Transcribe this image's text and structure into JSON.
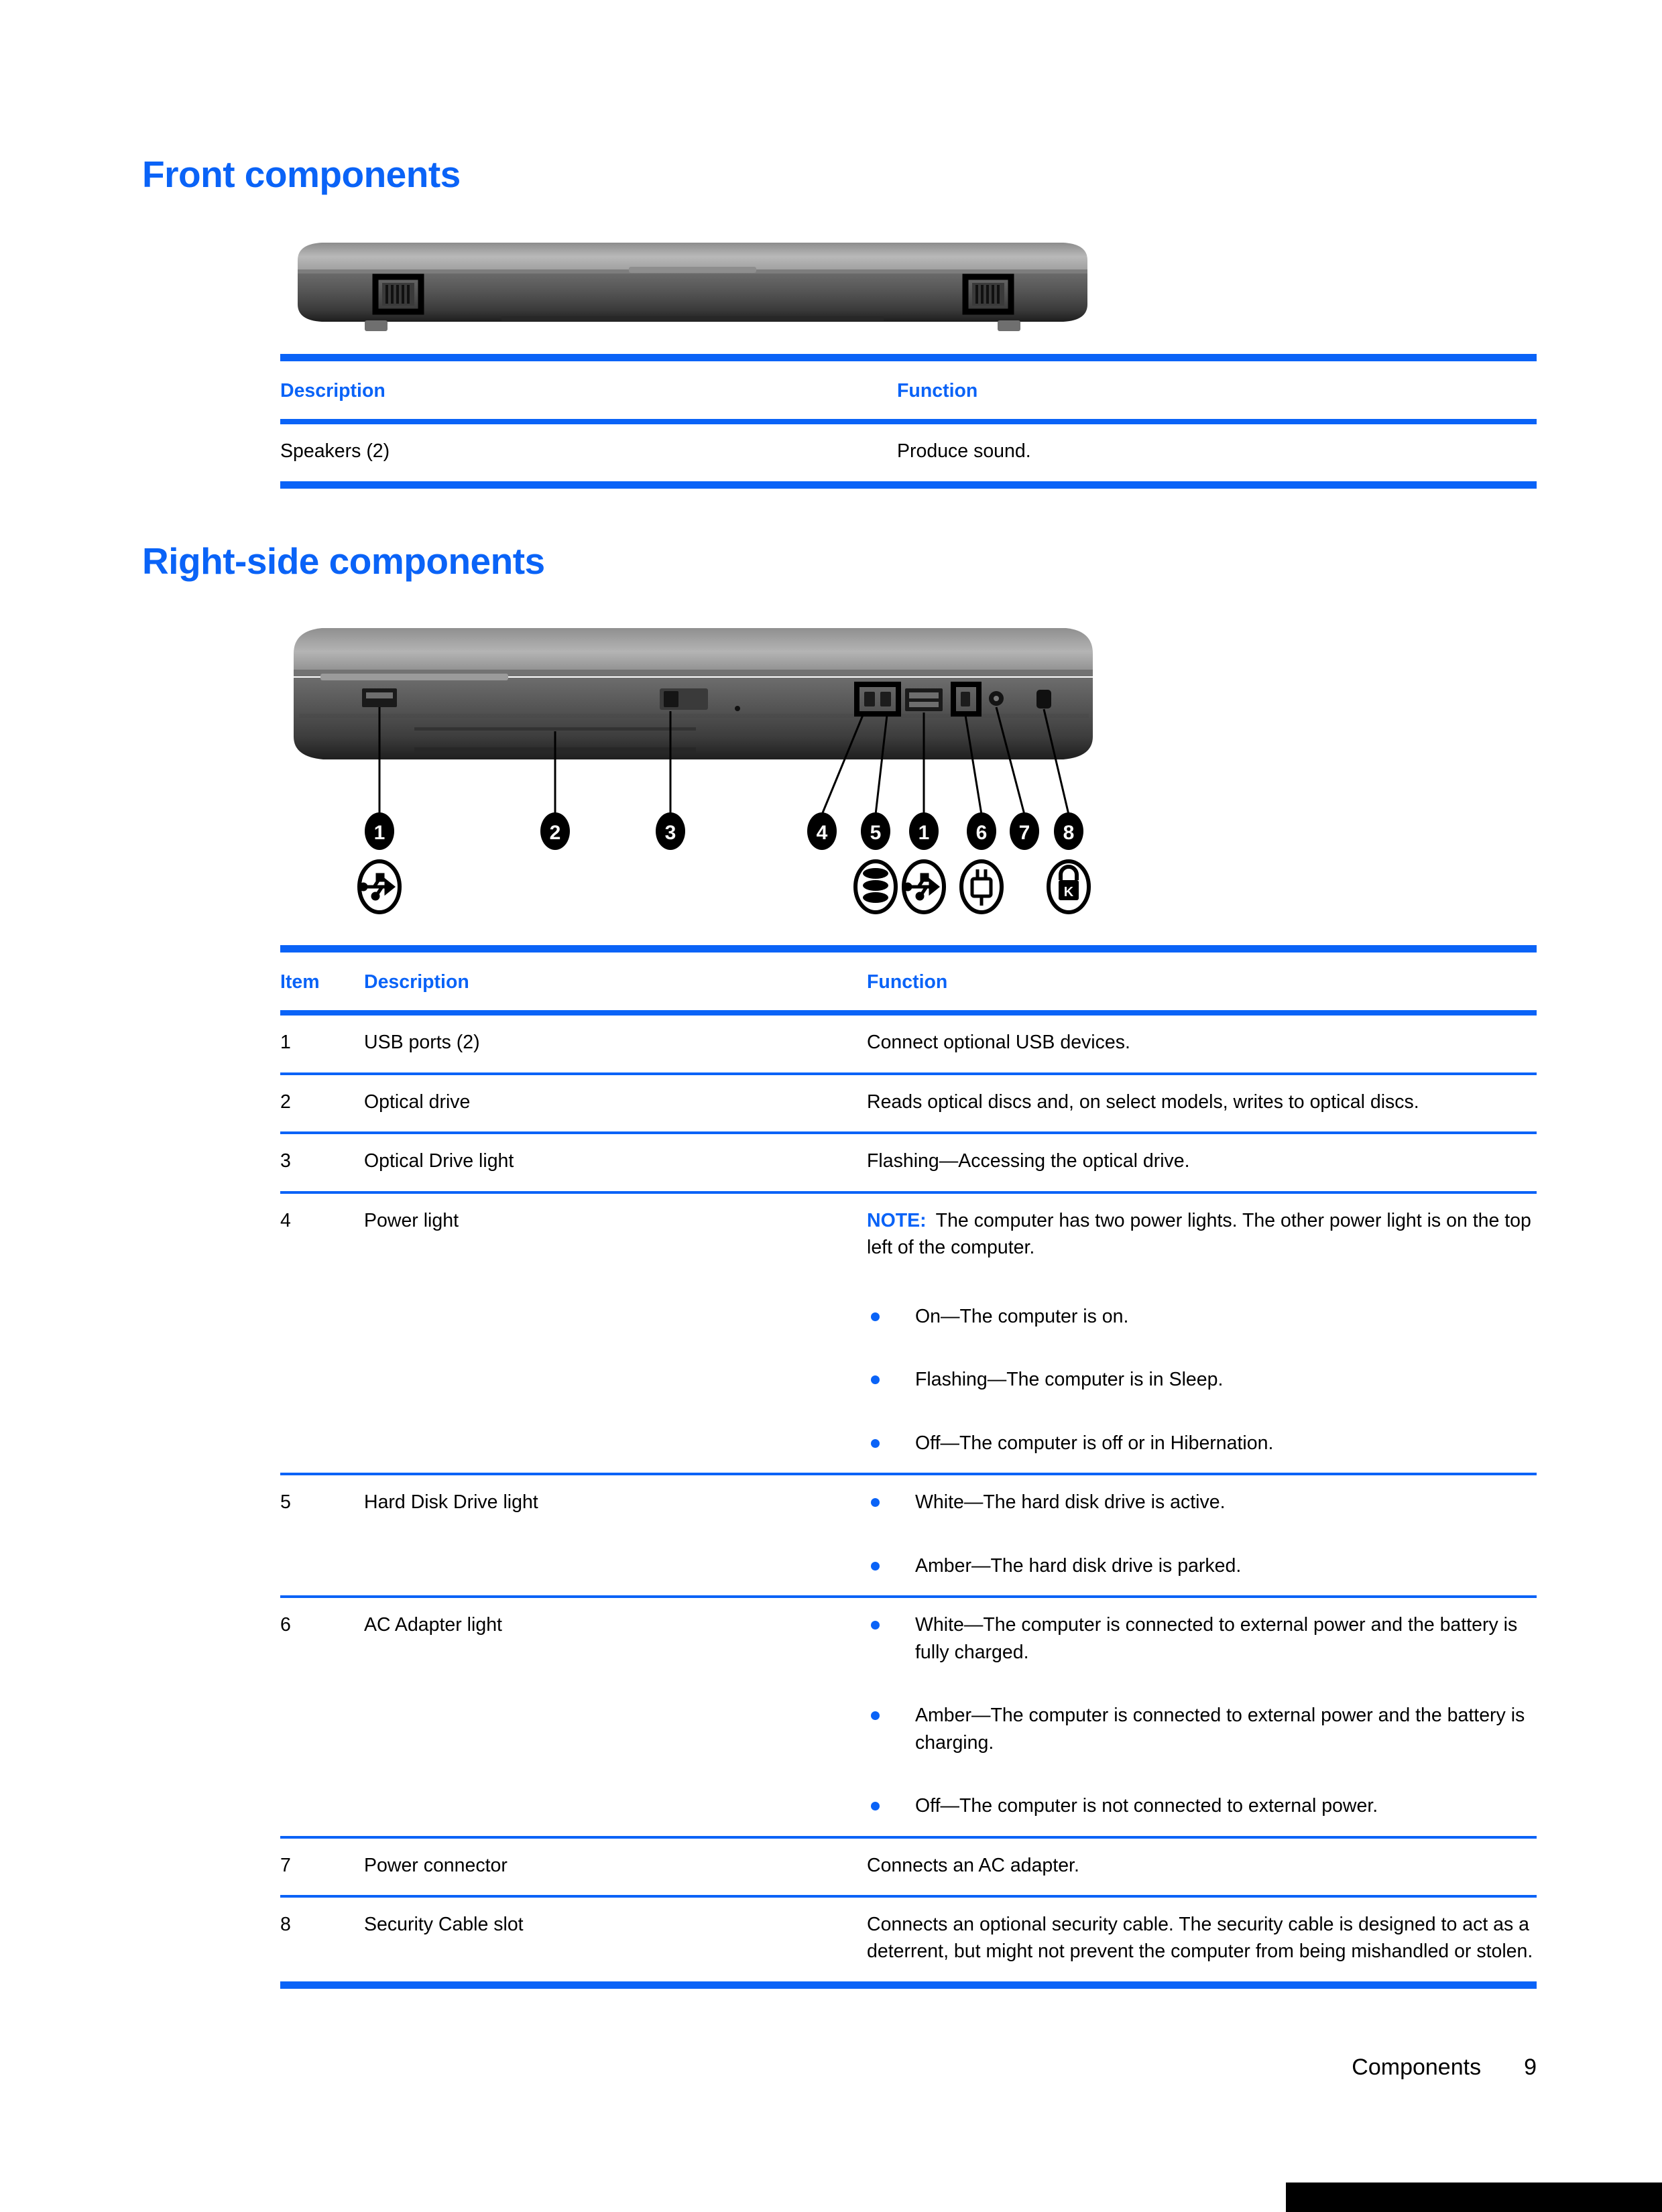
{
  "page": {
    "footer_chapter": "Components",
    "footer_page_number": "9",
    "accent_color": "#0a63f7"
  },
  "sections": {
    "front": {
      "heading": "Front components",
      "figure_alt": "front-edge-of-laptop-with-two-speaker-callouts",
      "table": {
        "headers": [
          "Description",
          "Function"
        ],
        "rows": [
          {
            "description": "Speakers (2)",
            "function": "Produce sound."
          }
        ]
      }
    },
    "right": {
      "heading": "Right-side components",
      "figure_alt": "right-side-of-laptop-with-numbered-callouts",
      "callouts": [
        "1",
        "2",
        "3",
        "4",
        "5",
        "1",
        "6",
        "7",
        "8"
      ],
      "callout_icons": [
        "usb-icon",
        "hard-drive-icon",
        "usb-icon",
        "power-plug-icon",
        "lock-icon"
      ],
      "table": {
        "headers": [
          "Item",
          "Description",
          "Function"
        ],
        "rows": [
          {
            "item": "1",
            "description": "USB ports (2)",
            "function": "Connect optional USB devices."
          },
          {
            "item": "2",
            "description": "Optical drive",
            "function": "Reads optical discs and, on select models, writes to optical discs."
          },
          {
            "item": "3",
            "description": "Optical Drive light",
            "function": "Flashing—Accessing the optical drive."
          },
          {
            "item": "4",
            "description": "Power light",
            "note_label": "NOTE:",
            "note_text": "The computer has two power lights. The other power light is on the top left of the computer.",
            "bullets": [
              "On—The computer is on.",
              "Flashing—The computer is in Sleep.",
              "Off—The computer is off or in Hibernation."
            ]
          },
          {
            "item": "5",
            "description": "Hard Disk Drive light",
            "bullets": [
              "White—The hard disk drive is active.",
              "Amber—The hard disk drive is parked."
            ]
          },
          {
            "item": "6",
            "description": "AC Adapter light",
            "bullets": [
              "White—The computer is connected to external power and the battery is fully charged.",
              "Amber—The computer is connected to external power and the battery is charging.",
              "Off—The computer is not connected to external power."
            ]
          },
          {
            "item": "7",
            "description": "Power connector",
            "function": "Connects an AC adapter."
          },
          {
            "item": "8",
            "description": "Security Cable slot",
            "function": "Connects an optional security cable. The security cable is designed to act as a deterrent, but might not prevent the computer from being mishandled or stolen."
          }
        ]
      }
    }
  }
}
